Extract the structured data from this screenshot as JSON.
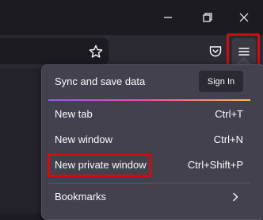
{
  "window_controls": {
    "minimize_icon": "minimize-icon",
    "restore_icon": "restore-icon",
    "close_icon": "close-icon"
  },
  "toolbar": {
    "bookmark_icon": "star-icon",
    "pocket_icon": "pocket-icon",
    "menu_icon": "hamburger-menu-icon"
  },
  "app_menu": {
    "sync_label": "Sync and save data",
    "signin_label": "Sign In",
    "items": [
      {
        "label": "New tab",
        "shortcut": "Ctrl+T"
      },
      {
        "label": "New window",
        "shortcut": "Ctrl+N"
      },
      {
        "label": "New private window",
        "shortcut": "Ctrl+Shift+P"
      },
      {
        "label": "Bookmarks",
        "shortcut": ""
      }
    ]
  },
  "colors": {
    "highlight": "#d10b10",
    "panel_bg": "#42414d",
    "toolbar_bg": "#2b2a33",
    "titlebar_bg": "#1c1b22",
    "text": "#fbfbfe"
  }
}
